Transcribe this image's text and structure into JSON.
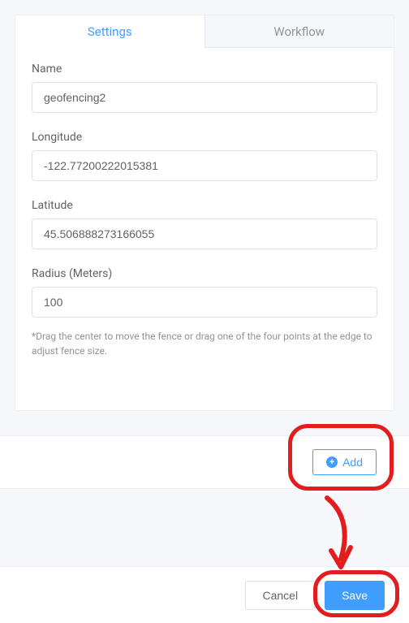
{
  "tabs": {
    "settings": "Settings",
    "workflow": "Workflow"
  },
  "fields": {
    "name": {
      "label": "Name",
      "value": "geofencing2"
    },
    "longitude": {
      "label": "Longitude",
      "value": "-122.77200222015381"
    },
    "latitude": {
      "label": "Latitude",
      "value": "45.506888273166055"
    },
    "radius": {
      "label": "Radius (Meters)",
      "value": "100"
    }
  },
  "hint": "*Drag the center to move the fence or drag one of the four points at the edge to adjust fence size.",
  "buttons": {
    "add": "Add",
    "cancel": "Cancel",
    "save": "Save"
  }
}
